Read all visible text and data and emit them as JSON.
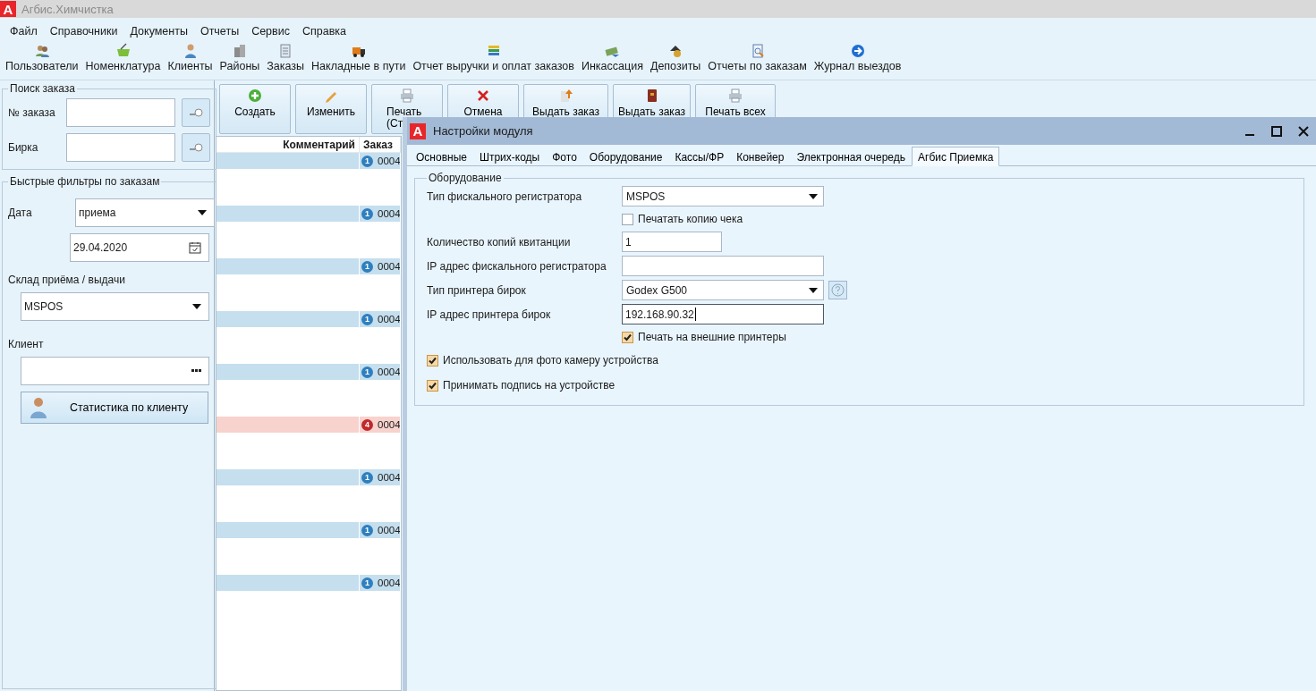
{
  "app": {
    "logo": "A",
    "title": "Агбис.Химчистка"
  },
  "menu": [
    "Файл",
    "Справочники",
    "Документы",
    "Отчеты",
    "Сервис",
    "Справка"
  ],
  "toolbar": [
    {
      "label": "Пользователи"
    },
    {
      "label": "Номенклатура"
    },
    {
      "label": "Клиенты"
    },
    {
      "label": "Районы"
    },
    {
      "label": "Заказы"
    },
    {
      "label": "Накладные в пути"
    },
    {
      "label": "Отчет выручки и оплат заказов"
    },
    {
      "label": "Инкассация"
    },
    {
      "label": "Депозиты"
    },
    {
      "label": "Отчеты по заказам"
    },
    {
      "label": "Журнал выездов"
    }
  ],
  "order_search": {
    "title": "Поиск заказа",
    "fields": [
      {
        "label": "№ заказа"
      },
      {
        "label": "Бирка"
      }
    ]
  },
  "quick_filters": {
    "title": "Быстрые фильтры по заказам",
    "date_label": "Дата",
    "date_type": "приема",
    "date": "29.04.2020",
    "warehouse_label": "Склад приёма / выдачи",
    "warehouse": "MSPOS",
    "client_label": "Клиент",
    "stats_button": "Статистика по клиенту"
  },
  "actions": [
    {
      "lines": [
        "Создать"
      ]
    },
    {
      "lines": [
        "Изменить"
      ]
    },
    {
      "lines": [
        "Печать",
        "(Ст"
      ]
    },
    {
      "lines": [
        "Отмена"
      ]
    },
    {
      "lines": [
        "Выдать заказ"
      ]
    },
    {
      "lines": [
        "Выдать заказ"
      ]
    },
    {
      "lines": [
        "Печать всех"
      ]
    }
  ],
  "orders_table": {
    "columns": [
      "Комментарий",
      "Заказ"
    ],
    "rows": [
      {
        "badge": "1",
        "order": "0004",
        "color": "#c5dfee"
      },
      {
        "badge": "1",
        "order": "0004",
        "color": "#c5dfee"
      },
      {
        "badge": "1",
        "order": "0004",
        "color": "#c5dfee"
      },
      {
        "badge": "1",
        "order": "0004",
        "color": "#c5dfee"
      },
      {
        "badge": "1",
        "order": "0004",
        "color": "#c5dfee"
      },
      {
        "badge": "4",
        "order": "0004",
        "color": "#f8d2cd"
      },
      {
        "badge": "1",
        "order": "0004",
        "color": "#c5dfee"
      },
      {
        "badge": "1",
        "order": "0004",
        "color": "#c5dfee"
      },
      {
        "badge": "1",
        "order": "0004",
        "color": "#c5dfee"
      }
    ]
  },
  "dialog": {
    "logo": "A",
    "title": "Настройки модуля",
    "tabs": [
      {
        "label": "Основные",
        "selected": false
      },
      {
        "label": "Штрих-коды",
        "selected": false
      },
      {
        "label": "Фото",
        "selected": false
      },
      {
        "label": "Оборудование",
        "selected": false
      },
      {
        "label": "Кассы/ФР",
        "selected": false
      },
      {
        "label": "Конвейер",
        "selected": false
      },
      {
        "label": "Электронная очередь",
        "selected": false
      },
      {
        "label": "Агбис Приемка",
        "selected": true
      }
    ],
    "group": "Оборудование",
    "fields": [
      {
        "kind": "select",
        "label": "Тип фискального регистратора",
        "value": "MSPOS",
        "help": false
      },
      {
        "kind": "checkbox",
        "label": "Печатать копию чека",
        "checked": false
      },
      {
        "kind": "short_input",
        "label": "Количество копий квитанции",
        "value": "1",
        "focused": false
      },
      {
        "kind": "input",
        "label": "IP адрес фискального регистратора",
        "focused": false
      },
      {
        "kind": "select",
        "label": "Тип принтера бирок",
        "value": "Godex G500",
        "help": true
      },
      {
        "kind": "input",
        "label": "IP адрес принтера бирок",
        "value": "192.168.90.32",
        "focused": true
      },
      {
        "kind": "checkbox",
        "label": "Печать на внешние принтеры",
        "checked": true
      },
      {
        "kind": "wide_checkbox",
        "label": "Использовать для фото камеру устройства",
        "checked": true
      },
      {
        "kind": "wide_checkbox",
        "label": "Принимать подпись на устройстве",
        "checked": true
      }
    ]
  }
}
